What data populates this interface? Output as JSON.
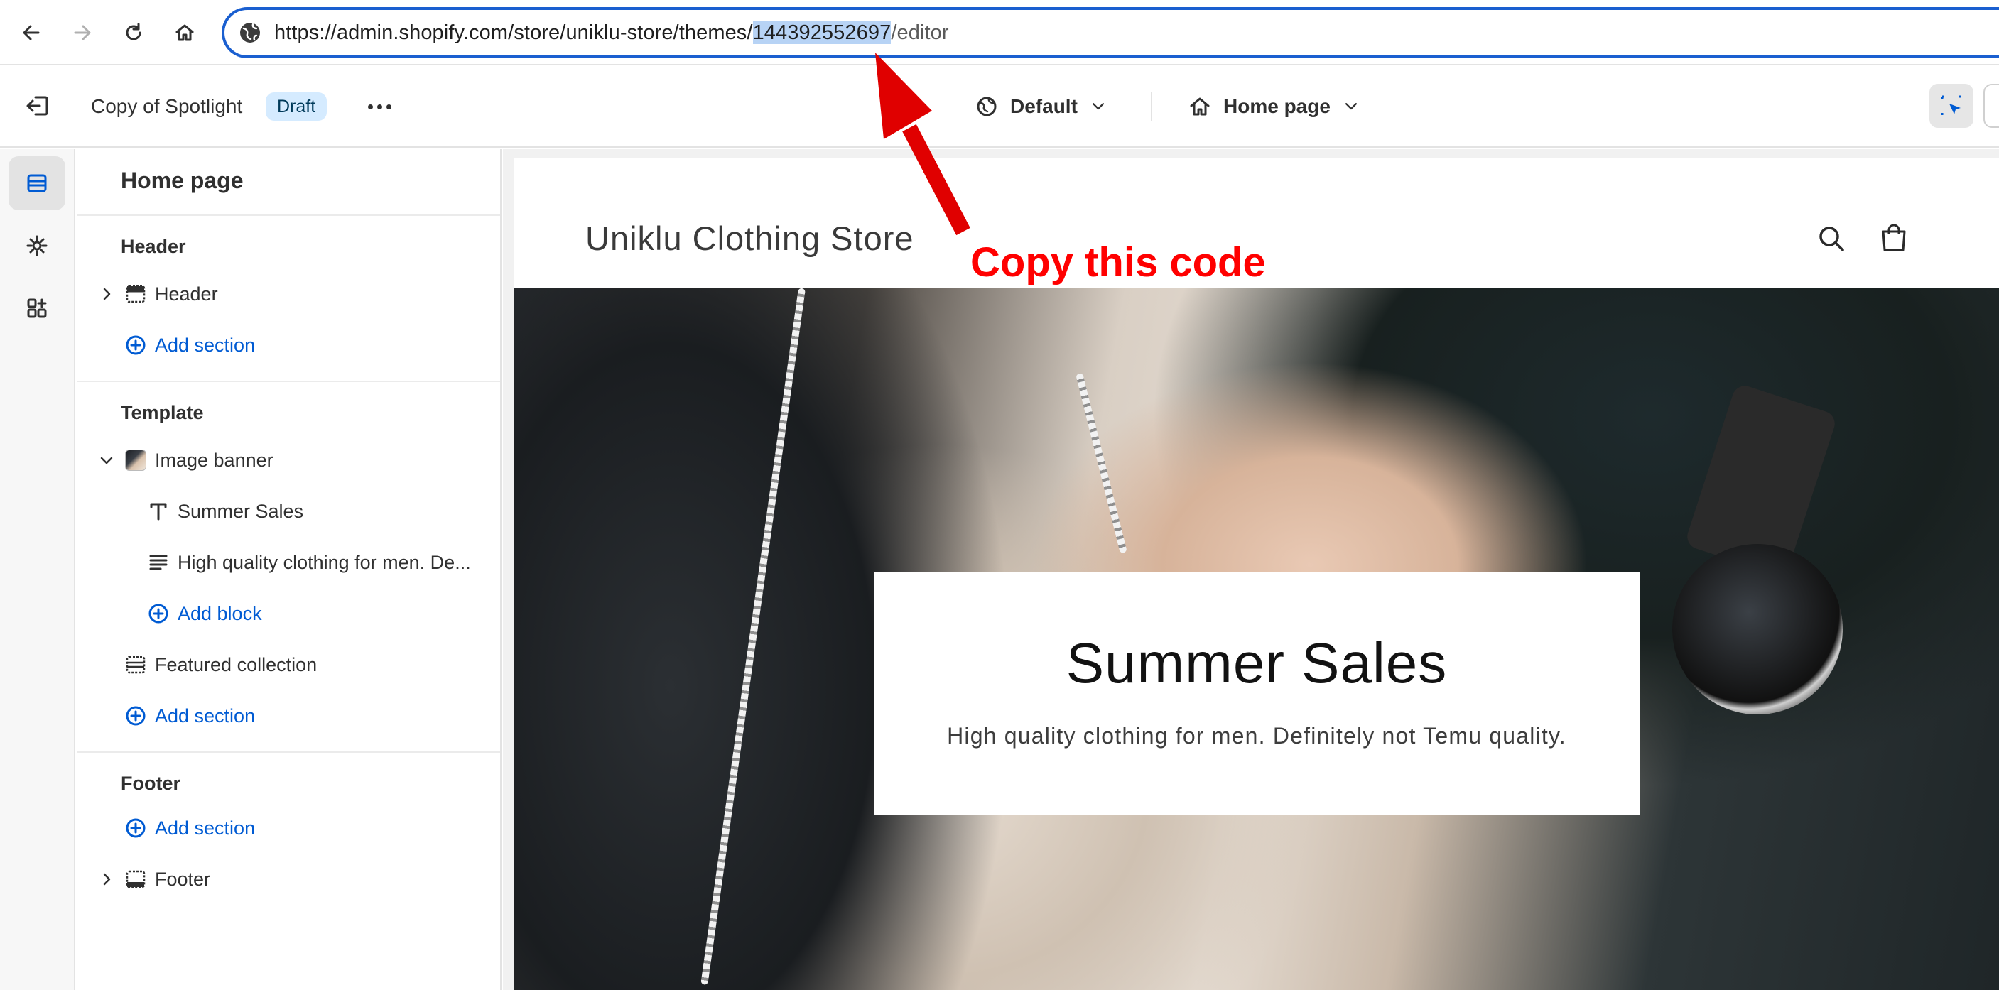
{
  "browser": {
    "url_prefix": "https://admin.shopify.com/store/uniklu-store/themes/",
    "url_highlight": "144392552697",
    "url_suffix": "/editor"
  },
  "editor_bar": {
    "theme_name": "Copy of Spotlight",
    "badge": "Draft",
    "theme_selector": "Default",
    "page_selector": "Home page"
  },
  "sidebar": {
    "title": "Home page",
    "header_group": {
      "heading": "Header",
      "items": [
        "Header"
      ],
      "add_section": "Add section"
    },
    "template_group": {
      "heading": "Template",
      "section": "Image banner",
      "blocks": [
        "Summer Sales",
        "High quality clothing for men. De..."
      ],
      "add_block": "Add block",
      "featured": "Featured collection",
      "add_section": "Add section"
    },
    "footer_group": {
      "heading": "Footer",
      "add_section": "Add section",
      "items": [
        "Footer"
      ]
    }
  },
  "preview": {
    "store_name": "Uniklu Clothing Store",
    "banner_title": "Summer Sales",
    "banner_text": "High quality clothing for men. Definitely not Temu quality."
  },
  "annotation": {
    "text": "Copy this code",
    "color": "#ff0000"
  },
  "colors": {
    "accent": "#005bd3",
    "url_focus": "#1a5fd0",
    "highlight": "#b7d3f5",
    "badge_bg": "#d5ebff"
  }
}
